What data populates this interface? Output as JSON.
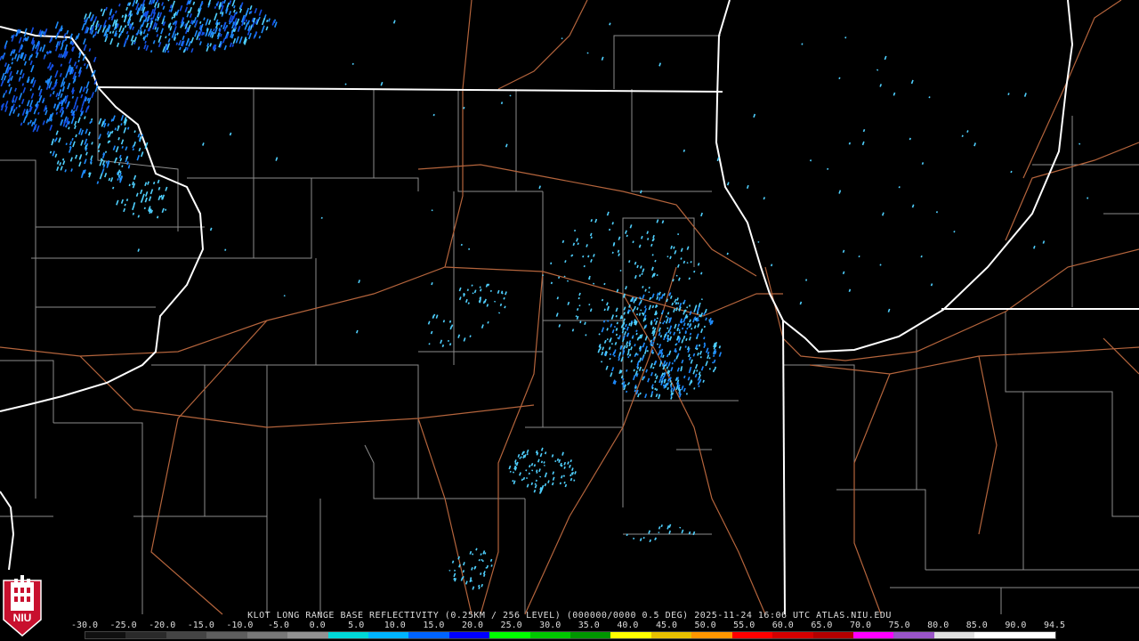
{
  "product": {
    "caption": "KLOT LONG RANGE BASE REFLECTIVITY (0.25KM / 256 LEVEL) (000000/0000 0.5 DEG) 2025-11-24 16:06 UTC  ATLAS.NIU.EDU"
  },
  "logo": {
    "text": "NIU",
    "colors": {
      "background": "#c8102e",
      "foreground": "#ffffff"
    }
  },
  "scale": {
    "labels": [
      "-30.0",
      "-25.0",
      "-20.0",
      "-15.0",
      "-10.0",
      "-5.0",
      "0.0",
      "5.0",
      "10.0",
      "15.0",
      "20.0",
      "25.0",
      "30.0",
      "35.0",
      "40.0",
      "45.0",
      "50.0",
      "55.0",
      "60.0",
      "65.0",
      "70.0",
      "75.0",
      "80.0",
      "85.0",
      "90.0",
      "94.5"
    ],
    "colors": [
      "#101010",
      "#2a2a2a",
      "#444444",
      "#5e5e5e",
      "#787878",
      "#929292",
      "#00d8d8",
      "#00b4ff",
      "#0064ff",
      "#0000ff",
      "#00ff00",
      "#00c800",
      "#009600",
      "#ffff00",
      "#e8c000",
      "#ff9600",
      "#ff0000",
      "#d40000",
      "#b40000",
      "#ff00ff",
      "#9a55c8",
      "#e0e0e0",
      "#ffffff",
      "#ffffff"
    ]
  },
  "map_colors": {
    "state_border": "#ffffff",
    "county_border": "#8c8c8c",
    "highway": "#b4643c",
    "echo_light": "#4fd0ff",
    "echo_mid": "#1e8cff",
    "echo_dark": "#1450e6"
  }
}
